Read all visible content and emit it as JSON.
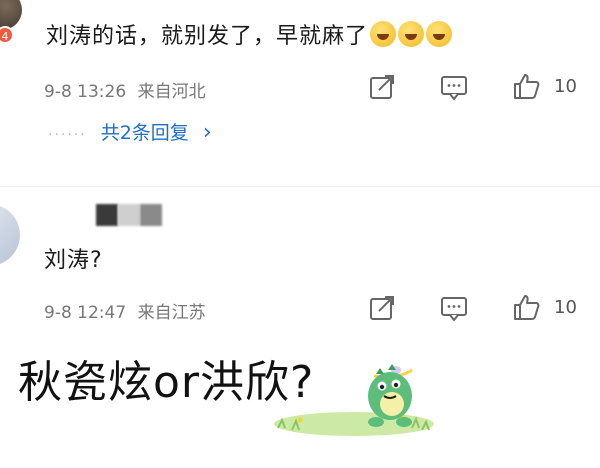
{
  "comment1": {
    "avatar_badge": "4",
    "text": "刘涛的话，就别发了，早就麻了",
    "emojis": [
      "laugh-cry-emoji",
      "laugh-cry-emoji",
      "laugh-cry-emoji"
    ],
    "date": "9-8 13:26",
    "location": "来自河北",
    "like_count": "10",
    "replies_label": "共2条回复",
    "replies_chevron": "›"
  },
  "comment2": {
    "text": "刘涛?",
    "date": "9-8 12:47",
    "location": "来自江苏",
    "like_count": "10"
  },
  "overlay": {
    "caption": "秋瓷炫or洪欣?"
  },
  "colors": {
    "link": "#1e6fc8",
    "meta": "#777777",
    "text": "#1a1a1a",
    "badge": "#f25a3a"
  }
}
